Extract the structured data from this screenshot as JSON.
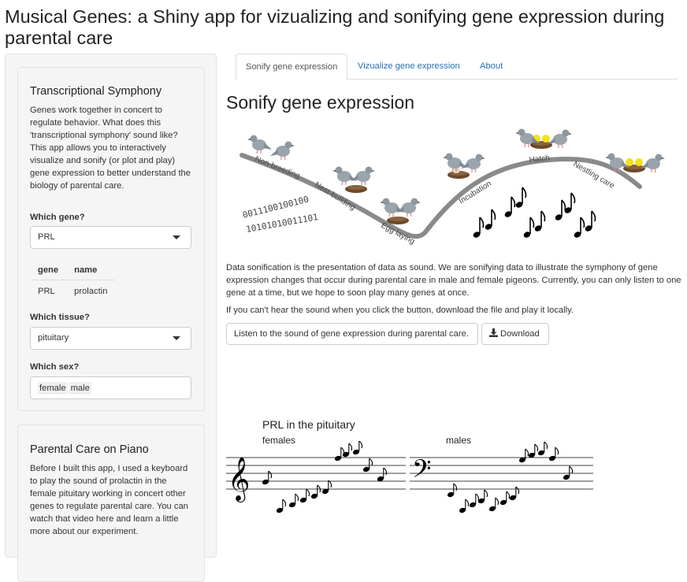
{
  "app": {
    "title": "Musical Genes: a Shiny app for vizualizing and sonifying gene expression during parental care"
  },
  "sidebar": {
    "panel1": {
      "heading": "Transcriptional Symphony",
      "text": "Genes work together in concert to regulate behavior. What does this 'transcriptional symphony' sound like? This app allows you to interactively visualize and sonify (or plot and play) gene expression to better understand the biology of parental care.",
      "gene_label": "Which gene?",
      "gene_value": "PRL",
      "table": {
        "headers": [
          "gene",
          "name"
        ],
        "rows": [
          [
            "PRL",
            "prolactin"
          ]
        ]
      },
      "tissue_label": "Which tissue?",
      "tissue_value": "pituitary",
      "sex_label": "Which sex?",
      "sex_values": [
        "female",
        "male"
      ]
    },
    "panel2": {
      "heading": "Parental Care on Piano",
      "text": "Before I built this app, I used a keyboard to play the sound of prolactin in the female pituitary working in concert other genes to regulate parental care. You can watch that video here and learn a little more about our experiment."
    }
  },
  "tabs": [
    {
      "label": "Sonify gene expression",
      "active": true
    },
    {
      "label": "Vizualize gene expression",
      "active": false
    },
    {
      "label": "About",
      "active": false
    }
  ],
  "main": {
    "heading": "Sonify gene expression",
    "illustration": {
      "stages": [
        "Non-breeding",
        "Nest-building",
        "Egg laying",
        "Incubation",
        "Hatch",
        "Nestling care"
      ],
      "binary_line_1": "0011100100100",
      "binary_line_2": "10101010011101"
    },
    "description": "Data sonification is the presentation of data as sound. We are sonifying data to illustrate the symphony of gene expression changes that occur during parental care in male and female pigeons. Currently, you can only listen to one gene at a time, but we hope to soon play many genes at once.",
    "hint": "If you can't hear the sound when you click the button, download the file and play it locally.",
    "listen_button": "Listen to the sound of gene expression during parental care.",
    "download_button": "Download",
    "score": {
      "title": "PRL in the pituitary",
      "female_label": "females",
      "male_label": "males"
    }
  },
  "colors": {
    "link": "#2a6fb4",
    "panel_bg": "#f5f5f5",
    "curve": "#8a8a8a",
    "pigeon": "#9aa4ad",
    "chick": "#f2e21c",
    "nest": "#6b4a2b"
  }
}
